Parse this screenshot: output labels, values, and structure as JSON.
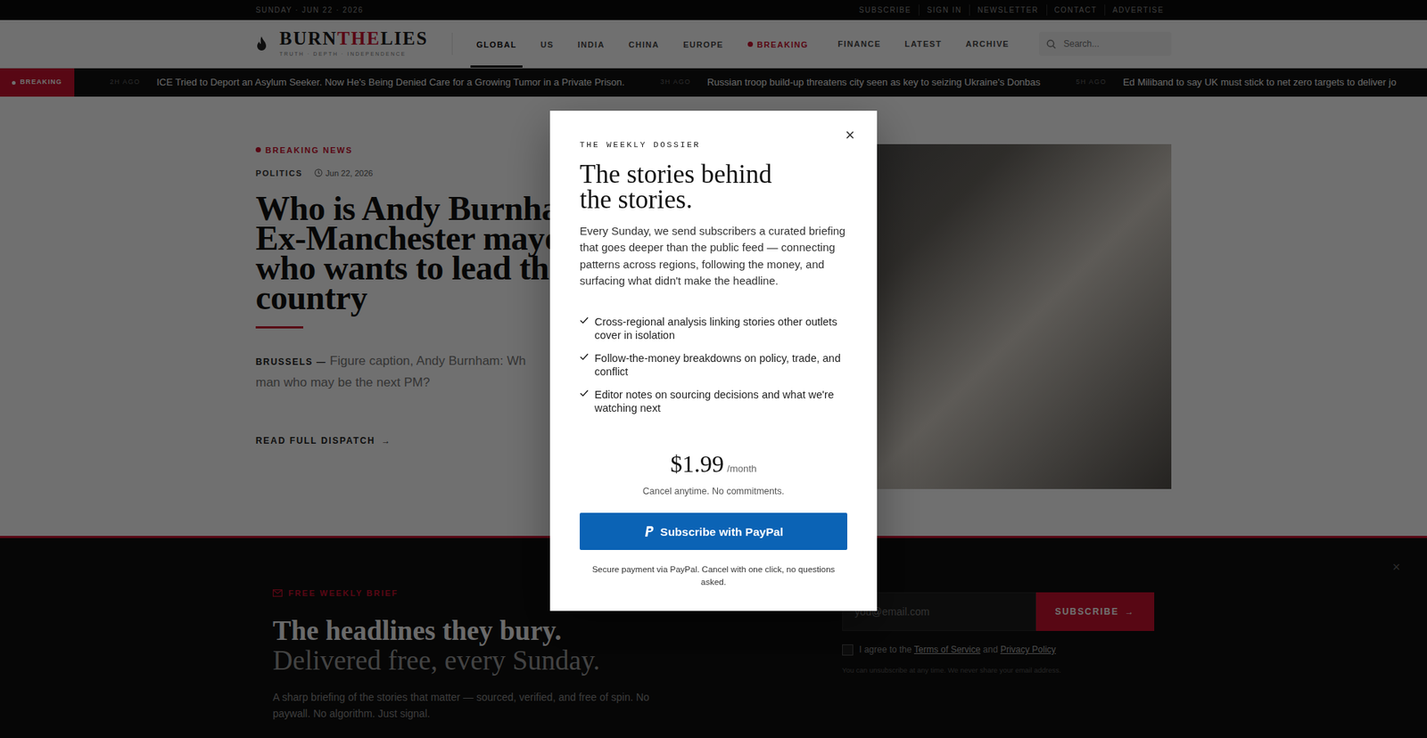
{
  "topbar": {
    "date": "SUNDAY · JUN 22 · 2026",
    "links": [
      "SUBSCRIBE",
      "SIGN IN",
      "NEWSLETTER",
      "CONTACT",
      "ADVERTISE"
    ]
  },
  "brand": {
    "parts": [
      "BURN",
      "THE",
      "LIES"
    ],
    "tagline": "TRUTH · DEPTH · INDEPENDENCE"
  },
  "nav": {
    "items": [
      {
        "label": "GLOBAL",
        "selected": true,
        "kind": "link"
      },
      {
        "label": "US",
        "selected": false,
        "kind": "link"
      },
      {
        "label": "INDIA",
        "selected": false,
        "kind": "link"
      },
      {
        "label": "CHINA",
        "selected": false,
        "kind": "link"
      },
      {
        "label": "EUROPE",
        "selected": false,
        "kind": "link"
      },
      {
        "label": "BREAKING",
        "selected": false,
        "kind": "alert"
      }
    ],
    "secondary": [
      "FINANCE",
      "LATEST",
      "ARCHIVE"
    ]
  },
  "search": {
    "placeholder": "Search..."
  },
  "ticker": {
    "label": "BREAKING",
    "items": [
      {
        "time": "2H AGO",
        "text": "ICE Tried to Deport an Asylum Seeker. Now He's Being Denied Care for a Growing Tumor in a Private Prison."
      },
      {
        "time": "3H AGO",
        "text": "Russian troop build-up threatens city seen as key to seizing Ukraine's Donbas"
      },
      {
        "time": "5H AGO",
        "text": "Ed Miliband to say UK must stick to net zero targets to deliver jo"
      }
    ]
  },
  "hero": {
    "kicker": "BREAKING NEWS",
    "category": "POLITICS",
    "date": "Jun 22, 2026",
    "headline": [
      "Who is Andy Burnha",
      "Ex-Manchester mayo",
      "who wants to lead th",
      "country"
    ],
    "dateline": "BRUSSELS —",
    "deck": [
      "Figure caption, Andy Burnham: Wh",
      "man who may be the next PM?"
    ],
    "read_more": "READ FULL DISPATCH",
    "arrow": "→"
  },
  "newsletter": {
    "label": "FREE WEEKLY BRIEF",
    "title": "The headlines they bury.",
    "subtitle": "Delivered free, every Sunday.",
    "body": "A sharp briefing of the stories that matter — sourced, verified, and free of spin. No paywall. No algorithm. Just signal.",
    "email_placeholder": "you@email.com",
    "button": "SUBSCRIBE",
    "arrow": "→",
    "consent": {
      "checked": false,
      "prefix": "I agree to the",
      "terms": "Terms of Service",
      "and": "and",
      "privacy": "Privacy Policy"
    },
    "fine_print": "You can unsubscribe at any time. We never share your email address.",
    "close": "×"
  },
  "modal": {
    "eyebrow": "THE WEEKLY DOSSIER",
    "title": [
      "The stories behind",
      "the stories."
    ],
    "body": "Every Sunday, we send subscribers a curated briefing that goes deeper than the public feed — connecting patterns across regions, following the money, and surfacing what didn't make the headline.",
    "features": [
      "Cross-regional analysis linking stories other outlets cover in isolation",
      "Follow-the-money breakdowns on policy, trade, and conflict",
      "Editor notes on sourcing decisions and what we're watching next"
    ],
    "price": "$1.99",
    "period": "/month",
    "price_note": "Cancel anytime. No commitments.",
    "button": "Subscribe with PayPal",
    "secure_note": "Secure payment via PayPal. Cancel with one click, no questions asked.",
    "close": "×"
  }
}
